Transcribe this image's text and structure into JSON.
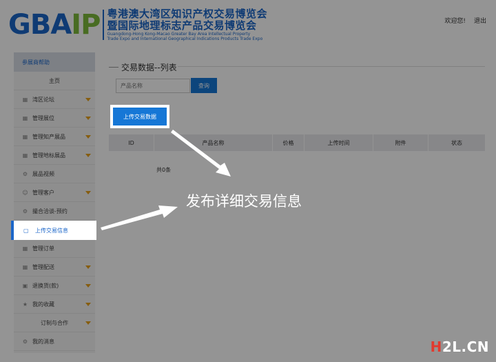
{
  "header": {
    "logo_main": "GBA",
    "logo_accent": "IP",
    "title_line1": "粤港澳大湾区知识产权交易博览会",
    "title_line2": "暨国际地理标志产品交易博览会",
    "subtitle_en_1": "Guangdong-Hong Kong-Macao Greater Bay Area Intellectual Property",
    "subtitle_en_2": "Trade Expo and International Geographical Indications Products Trade Expo",
    "welcome": "欢迎您!",
    "logout": "退出"
  },
  "sidebar": {
    "heading": "参展商帮助",
    "items": [
      {
        "label": "主页",
        "icon": "none",
        "caret": false,
        "center": true
      },
      {
        "label": "湾区论坛",
        "icon": "grid-icon",
        "caret": true
      },
      {
        "label": "管理展位",
        "icon": "grid-icon",
        "caret": true
      },
      {
        "label": "管理知产展品",
        "icon": "grid-icon",
        "caret": true
      },
      {
        "label": "管理地标展品",
        "icon": "grid-icon",
        "caret": true
      },
      {
        "label": "展品视频",
        "icon": "gear-icon",
        "caret": false
      },
      {
        "label": "管理客户",
        "icon": "user-icon",
        "caret": true
      },
      {
        "label": "撮合洽谈-预约",
        "icon": "gear-icon",
        "caret": false
      },
      {
        "label": "上传交易信息",
        "icon": "document-icon",
        "caret": false,
        "active": true
      },
      {
        "label": "管理订单",
        "icon": "grid-icon",
        "caret": false
      },
      {
        "label": "管理配送",
        "icon": "grid-icon",
        "caret": true
      },
      {
        "label": "退换货(款)",
        "icon": "lock-icon",
        "caret": true
      },
      {
        "label": "我的收藏",
        "icon": "star-icon",
        "caret": true
      },
      {
        "label": "订制与合作",
        "icon": "none",
        "caret": true,
        "center": true
      },
      {
        "label": "我的消息",
        "icon": "gear-icon",
        "caret": false
      }
    ]
  },
  "main": {
    "section_title": "交易数据--列表",
    "search_placeholder": "产品名称",
    "search_button": "查询",
    "upload_button": "上传交易数据",
    "columns": [
      "ID",
      "产品名称",
      "价格",
      "上传时间",
      "附件",
      "状态"
    ],
    "total": "共0条"
  },
  "annotation": "发布详细交易信息",
  "watermark": {
    "prefix": "H",
    "rest": "2L.CN"
  }
}
